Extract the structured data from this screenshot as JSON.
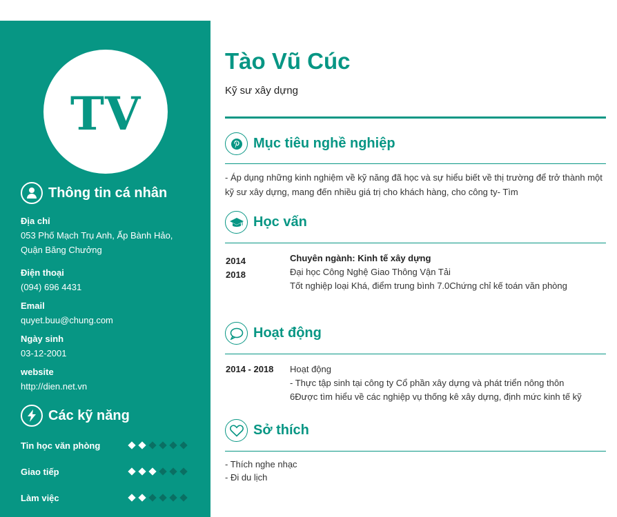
{
  "sidebar": {
    "avatar_initials": "TV",
    "personal_heading": "Thông tin cá nhân",
    "address_label": "Địa chỉ",
    "address_value": "053 Phố Mạch Trụ Anh, Ấp Bành Hảo, Quận Băng Chưởng",
    "phone_label": "Điện thoại",
    "phone_value": "(094) 696 4431",
    "email_label": "Email",
    "email_value": "quyet.buu@chung.com",
    "birthday_label": "Ngày sinh",
    "birthday_value": "03-12-2001",
    "website_label": "website",
    "website_value": "http://dien.net.vn",
    "skills_heading": "Các kỹ năng",
    "skills": [
      {
        "name": "Tin học văn phòng",
        "level": 2,
        "max": 6
      },
      {
        "name": "Giao tiếp",
        "level": 3,
        "max": 6
      },
      {
        "name": "Làm việc",
        "level": 2,
        "max": 6
      }
    ]
  },
  "main": {
    "name": "Tào Vũ Cúc",
    "job_title": "Kỹ sư xây dựng",
    "objective": {
      "heading": "Mục tiêu nghề nghiệp",
      "text": "- Áp dụng những kinh nghiệm về kỹ năng đã học và sự hiểu biết về thị trường để trở thành một kỹ sư xây dựng, mang đến nhiều giá trị cho khách hàng, cho công ty- Tìm"
    },
    "education": {
      "heading": "Học vấn",
      "start": "2014",
      "end": "2018",
      "major": "Chuyên ngành: Kinh tế xây dựng",
      "school": "Đại học Công Nghệ Giao Thông Vận Tải",
      "detail": "Tốt nghiệp loại Khá, điểm trung bình 7.0Chứng chỉ kế toán văn phòng"
    },
    "activities": {
      "heading": "Hoạt động",
      "period": "2014  - 2018",
      "title": "Hoạt động",
      "line1": "- Thực tập sinh tại công ty Cổ phần xây dựng và phát triển nông thôn",
      "line2": "6Được tìm hiểu về các nghiệp vụ thống kê xây dựng, định mức kinh tế kỹ"
    },
    "hobbies": {
      "heading": "Sở thích",
      "items": [
        "- Thích nghe nhạc",
        "- Đi du lịch"
      ]
    }
  },
  "icons": {
    "personal": "user-icon",
    "skills": "lightning-icon",
    "objective": "pinterest-icon",
    "education": "graduation-cap-icon",
    "activities": "chat-bubble-icon",
    "hobbies": "heart-icon"
  },
  "colors": {
    "accent": "#079684",
    "sidebar_bg": "#079684",
    "skill_off": "#0a6f63"
  }
}
